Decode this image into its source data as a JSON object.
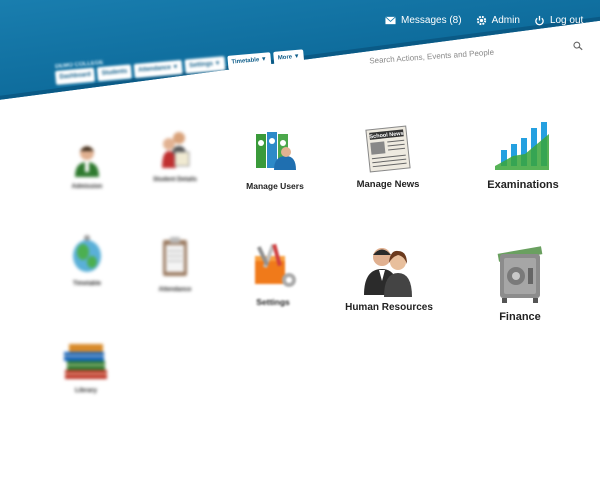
{
  "header": {
    "messages_label": "Messages (8)",
    "admin_label": "Admin",
    "logout_label": "Log out",
    "college_name": "DEMO COLLEGE",
    "search_placeholder": "Search Actions, Events and People"
  },
  "nav": {
    "tabs": [
      "Dashboard",
      "Students",
      "Attendance ▼",
      "Settings ▼",
      "Timetable ▼",
      "More ▼"
    ]
  },
  "tiles": [
    {
      "label": "Admission",
      "icon": "admission-icon"
    },
    {
      "label": "Student Details",
      "icon": "student-details-icon"
    },
    {
      "label": "Manage Users",
      "icon": "manage-users-icon"
    },
    {
      "label": "Manage News",
      "icon": "manage-news-icon"
    },
    {
      "label": "Examinations",
      "icon": "examinations-icon"
    },
    {
      "label": "Timetable",
      "icon": "timetable-icon"
    },
    {
      "label": "Attendance",
      "icon": "attendance-icon"
    },
    {
      "label": "Settings",
      "icon": "settings-icon"
    },
    {
      "label": "Human Resources",
      "icon": "human-resources-icon"
    },
    {
      "label": "Finance",
      "icon": "finance-icon"
    },
    {
      "label": "Library",
      "icon": "library-icon"
    }
  ],
  "colors": {
    "header_blue": "#1a7fb0",
    "accent_green": "#3aa63a"
  },
  "news_icon_text": "School News"
}
